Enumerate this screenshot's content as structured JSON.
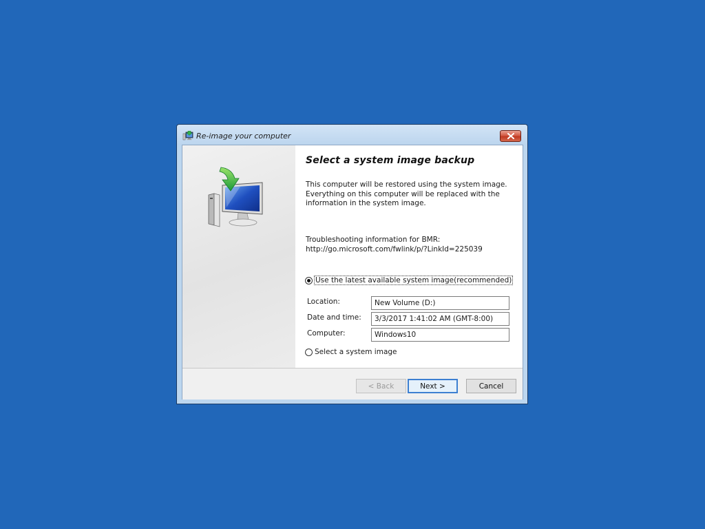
{
  "window": {
    "title": "Re-image your computer",
    "icon": "reimage-app-icon"
  },
  "main": {
    "title": "Select a system image backup",
    "description": "This computer will be restored using the system image. Everything on this computer will be replaced with the information in the system image.",
    "troubleshooting_label": "Troubleshooting information for BMR:",
    "troubleshooting_link": "http://go.microsoft.com/fwlink/p/?LinkId=225039"
  },
  "options": {
    "latest": {
      "label": "Use the latest available system image(recommended)",
      "selected": true
    },
    "select": {
      "label": "Select a system image",
      "selected": false
    }
  },
  "details": {
    "location_label": "Location:",
    "location_value": "New Volume (D:)",
    "datetime_label": "Date and time:",
    "datetime_value": "3/3/2017 1:41:02 AM (GMT-8:00)",
    "computer_label": "Computer:",
    "computer_value": "Windows10"
  },
  "buttons": {
    "back": "< Back",
    "next": "Next >",
    "cancel": "Cancel"
  },
  "colors": {
    "desktop": "#2167b9",
    "close_button": "#c13a22",
    "default_button_border": "#3c7fd1"
  }
}
